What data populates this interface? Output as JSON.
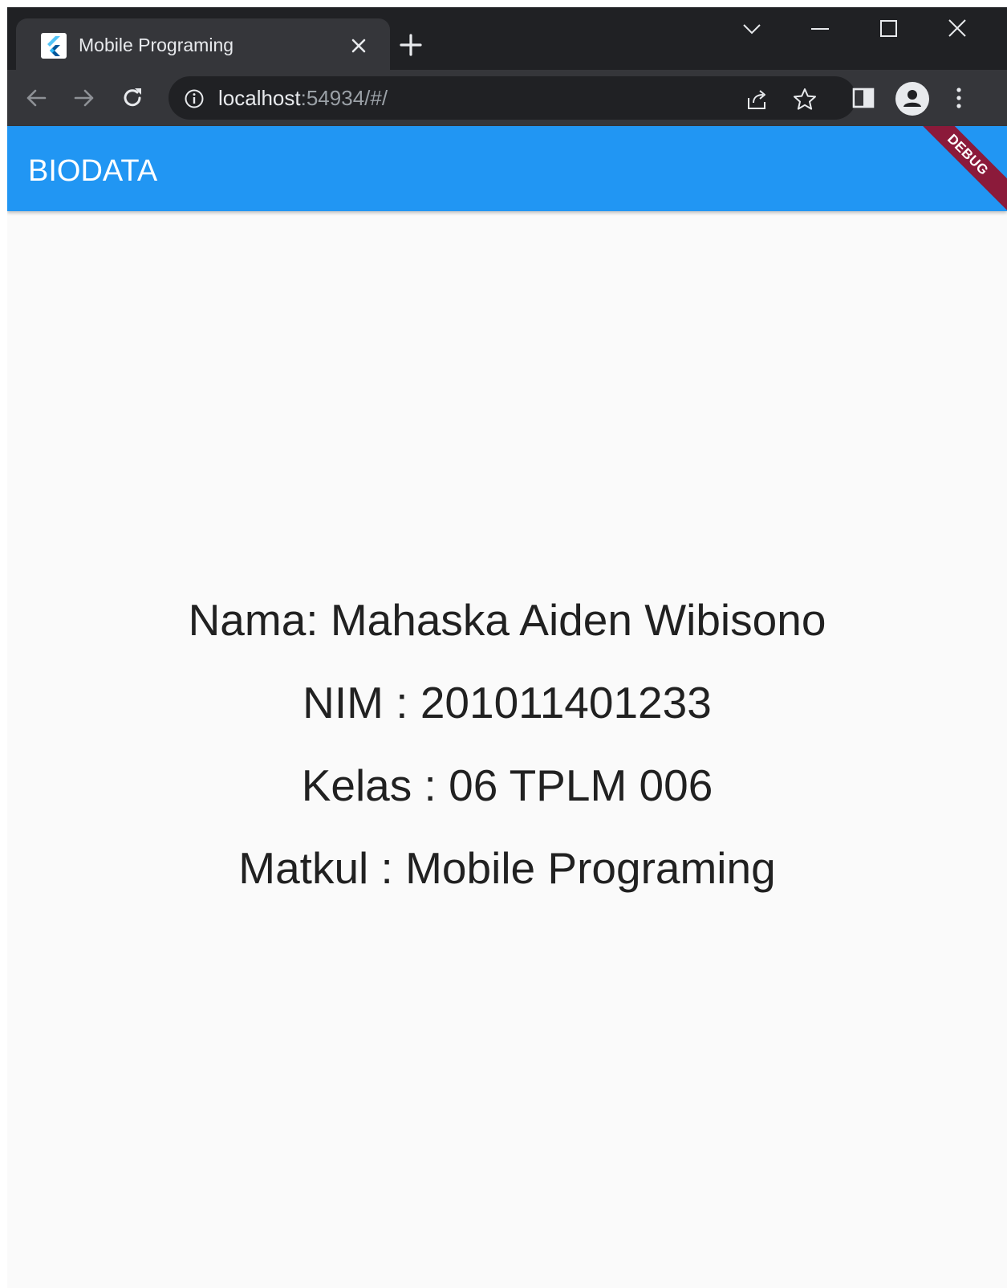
{
  "browser": {
    "tab": {
      "title": "Mobile Programing",
      "favicon": "flutter-icon"
    },
    "address_bar": {
      "host": "localhost",
      "rest": ":54934/#/"
    },
    "icons": [
      "back-icon",
      "forward-icon",
      "reload-icon",
      "info-icon",
      "share-icon",
      "star-icon",
      "side-panel-icon",
      "profile-icon",
      "menu-icon",
      "tab-search-icon",
      "minimize-icon",
      "maximize-icon",
      "close-icon",
      "plus-icon"
    ]
  },
  "app": {
    "appbar": {
      "title": "BIODATA",
      "color": "#2196f3"
    },
    "debug_banner": "DEBUG",
    "biodata": {
      "nama": "Nama: Mahaska Aiden Wibisono",
      "nim": "NIM : 201011401233",
      "kelas": "Kelas : 06 TPLM 006",
      "matkul": "Matkul : Mobile Programing"
    }
  }
}
